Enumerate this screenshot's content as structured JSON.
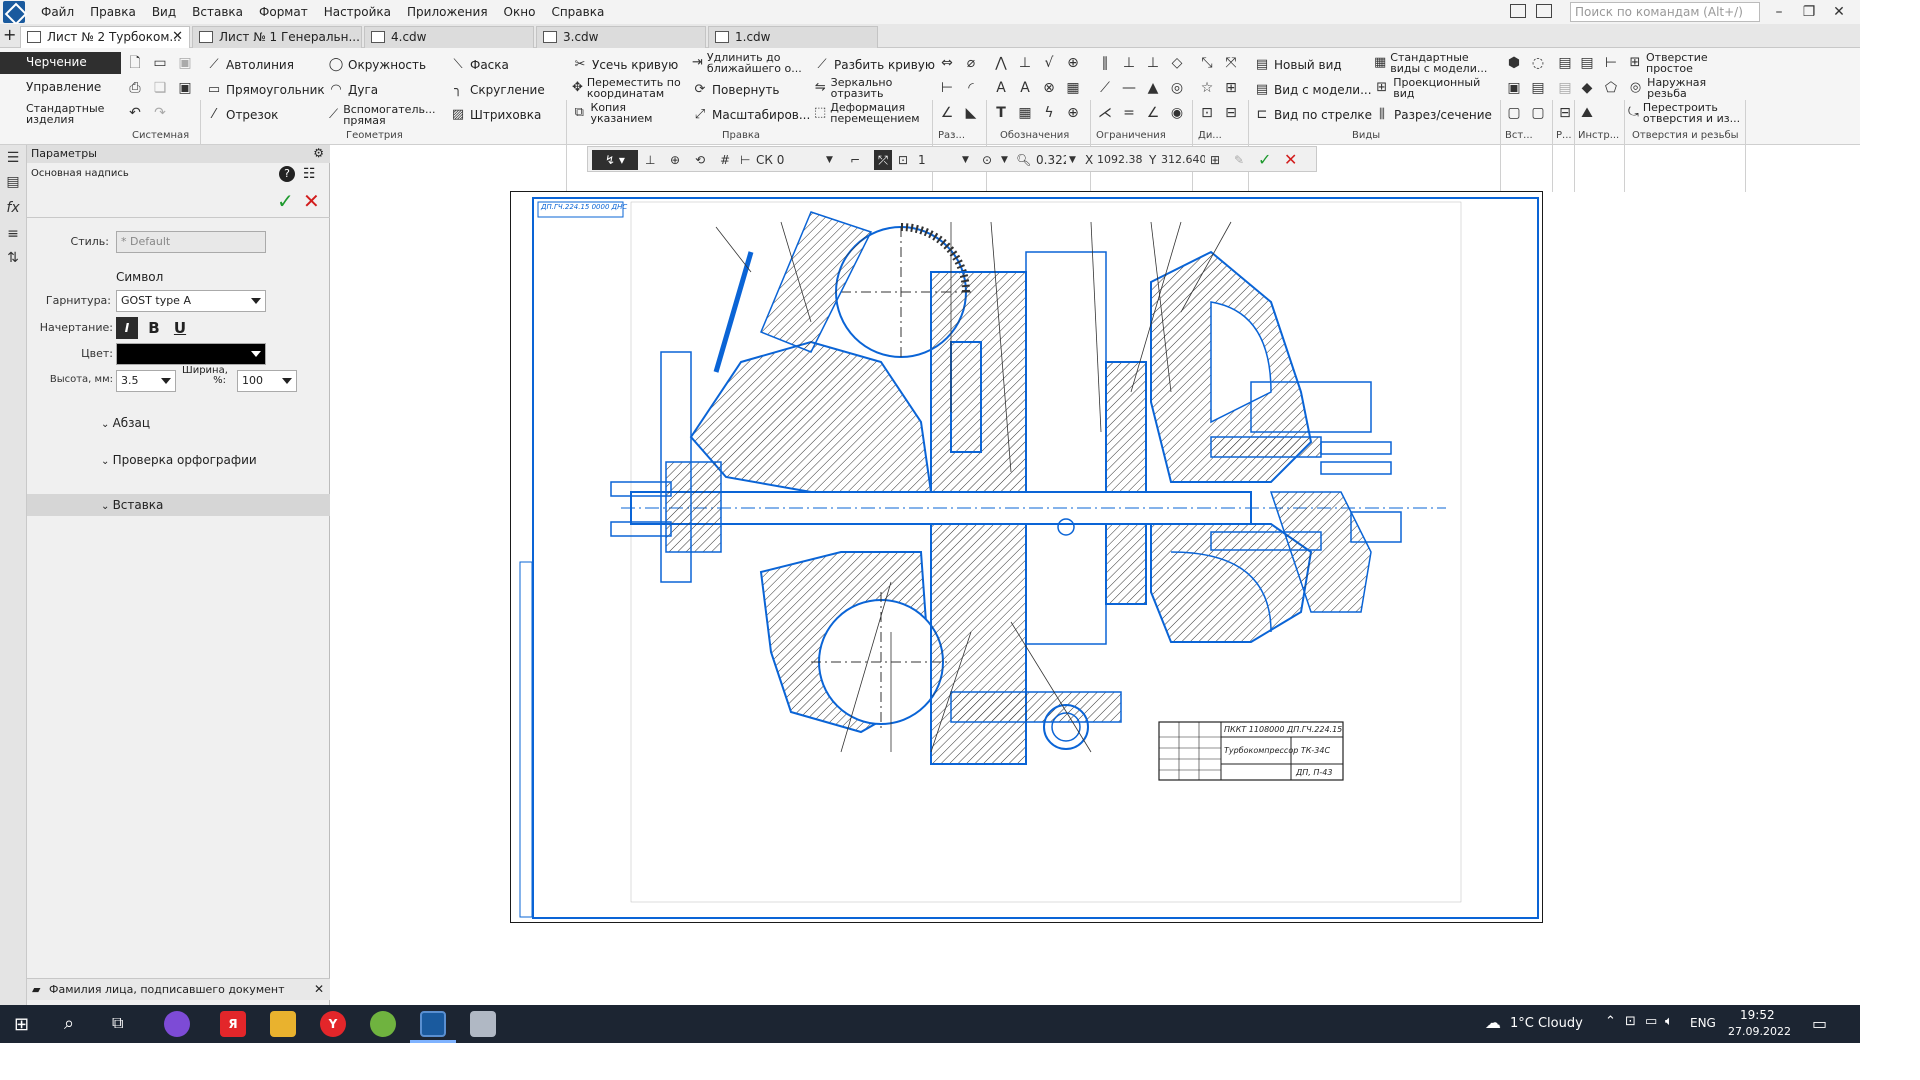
{
  "menu": [
    "Файл",
    "Правка",
    "Вид",
    "Вставка",
    "Формат",
    "Настройка",
    "Приложения",
    "Окно",
    "Справка"
  ],
  "search": {
    "placeholder": "Поиск по командам (Alt+/)"
  },
  "tabs": [
    {
      "label": "Лист № 2 Турбоком...",
      "active": true
    },
    {
      "label": "Лист № 1 Генеральн...",
      "active": false
    },
    {
      "label": "4.cdw",
      "active": false
    },
    {
      "label": "3.cdw",
      "active": false
    },
    {
      "label": "1.cdw",
      "active": false
    }
  ],
  "ribbon": {
    "modes": [
      "Черчение",
      "Управление",
      "Стандартные изделия"
    ],
    "groups": {
      "system": "Системная",
      "geometry": "Геометрия",
      "edit": "Правка",
      "dim": "Раз...",
      "notation": "Обозначения",
      "constraints": "Ограничения",
      "di": "Ди...",
      "views": "Виды",
      "insert": "Вст...",
      "r": "Р...",
      "instr": "Инстр...",
      "holes": "Отверстия и резьбы"
    },
    "geometry": [
      "Автолиния",
      "Окружность",
      "Фаска",
      "Прямоугольник",
      "Дуга",
      "Скругление",
      "Отрезок",
      "Вспомогатель... прямая",
      "Штриховка"
    ],
    "edit": [
      "Усечь кривую",
      "Удлинить до ближайшего о...",
      "Разбить кривую",
      "Переместить по координатам",
      "Повернуть",
      "Зеркально отразить",
      "Копия указанием",
      "Масштабиров...",
      "Деформация перемещением"
    ],
    "views": [
      "Новый вид",
      "Стандартные виды с модели...",
      "Вид с модели...",
      "Проекционный вид",
      "Вид по стрелке",
      "Разрез/сечение"
    ],
    "holes": [
      "Отверстие простое",
      "Наружная резьба",
      "Перестроить отверстия и из..."
    ]
  },
  "panel": {
    "title": "Параметры",
    "subtitle": "Основная надпись",
    "style_label": "Стиль:",
    "style_value": "* Default",
    "symbol_heading": "Символ",
    "font_label": "Гарнитура:",
    "font_value": "GOST type A",
    "style_type_label": "Начертание:",
    "italic": "I",
    "bold": "B",
    "underline": "U",
    "color_label": "Цвет:",
    "color_value": "#000000",
    "height_label": "Высота, мм:",
    "height_value": "3.5",
    "width_label": "Ширина, %:",
    "width_value": "100",
    "sections": [
      "Абзац",
      "Проверка орфографии",
      "Вставка"
    ],
    "hint": "Фамилия лица, подписавшего документ"
  },
  "float_toolbar": {
    "cs": "СК 0",
    "layer": "1",
    "zoom": "0.322",
    "x_label": "X",
    "x_value": "1092.38",
    "y_label": "Y",
    "y_value": "312.640"
  },
  "drawing": {
    "stamp_code": "ПККТ 1108000 ДП.ГЧ.224.15",
    "stamp_title": "Турбокомпрессор ТК-34С",
    "stamp_sheet": "ДП, П-43",
    "corner_code": "ДП.ГЧ.224.15 0000 ДНС"
  },
  "taskbar": {
    "weather": "1°C Cloudy",
    "lang": "ENG",
    "time": "19:52",
    "date": "27.09.2022"
  },
  "colors": {
    "accent_blue": "#0a64d6",
    "dark_mode_button": "#2f2f2f",
    "taskbar": "#1c2532",
    "confirm": "#1e9a2e",
    "cancel": "#d21c1c"
  }
}
